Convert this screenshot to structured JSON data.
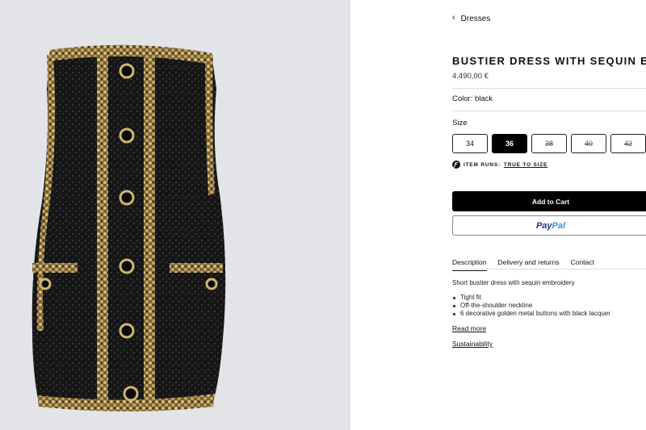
{
  "breadcrumb": {
    "label": "Dresses"
  },
  "product": {
    "title": "BUSTIER DRESS WITH SEQUIN EMBR",
    "price": "4.490,00 €",
    "color_label": "Color:",
    "color_value": "black",
    "size_label": "Size"
  },
  "sizes": [
    {
      "label": "34",
      "state": "available"
    },
    {
      "label": "36",
      "state": "selected"
    },
    {
      "label": "38",
      "state": "unavailable"
    },
    {
      "label": "40",
      "state": "unavailable"
    },
    {
      "label": "42",
      "state": "unavailable"
    }
  ],
  "fit": {
    "prefix": "ITEM RUNS:",
    "link": "TRUE TO SIZE"
  },
  "buttons": {
    "add_to_cart": "Add to Cart",
    "paypal_pay": "Pay",
    "paypal_pal": "Pal"
  },
  "tabs": [
    {
      "label": "Description",
      "active": true
    },
    {
      "label": "Delivery and returns",
      "active": false
    },
    {
      "label": "Contact",
      "active": false
    }
  ],
  "description": {
    "summary": "Short bustier dress with sequin embroidery",
    "bullets": [
      "Tight fit",
      "Off-the-shoulder neckline",
      "6 decorative golden metal buttons with black lacquer"
    ],
    "read_more": "Read more",
    "sustainability": "Sustainability"
  },
  "colors": {
    "panel_bg": "#e3e4e8",
    "dress": "#141414",
    "trim": "#b89a5c",
    "accent_black": "#000000"
  }
}
